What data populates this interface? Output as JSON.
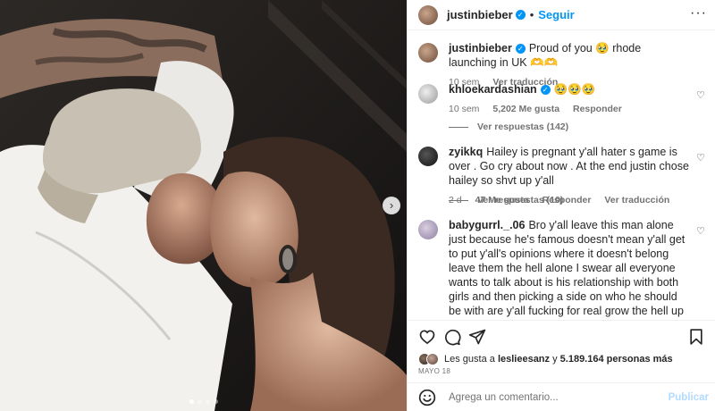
{
  "header": {
    "username": "justinbieber",
    "separator": "•",
    "follow_label": "Seguir",
    "more_icon": "more-horizontal-icon"
  },
  "caption": {
    "username": "justinbieber",
    "text": "Proud of you 🥹 rhode launching in UK 🫶🫶",
    "time": "10 sem",
    "translate": "Ver traducción"
  },
  "comments": [
    {
      "username": "khloekardashian",
      "verified": true,
      "text": "🥹🥹🥹",
      "time": "10 sem",
      "likes": "5,202 Me gusta",
      "reply": "Responder",
      "replies": "Ver respuestas (142)"
    },
    {
      "username": "zyikkq",
      "verified": false,
      "text": "Hailey is pregnant y'all hater s game is over . Go cry about now . At the end justin chose hailey so shvt up y'all",
      "time": "2 d",
      "likes": "47 Me gusta",
      "reply": "Responder",
      "translate": "Ver traducción",
      "replies": "Ver respuestas (10)"
    },
    {
      "username": "babygurrl._.06",
      "verified": false,
      "text": "Bro y'all leave this man alone just because he's famous doesn't mean y'all get to put y'all's opinions where it doesn't belong leave them the hell alone I swear all everyone wants to talk about is his relationship with both girls and then picking a side on who he should be with are y'all fucking for real grow the hell up and get off his page if you don't like the girl he's with unfollow him at this point y'all are making their lives Miserable they are happy with their marriage let them be"
    }
  ],
  "likes": {
    "prefix": "Les gusta a",
    "user": "leslieesanz",
    "connector": "y",
    "others": "5.189.164 personas más"
  },
  "date": "MAYO 18",
  "composer": {
    "placeholder": "Agrega un comentario...",
    "publish_label": "Publicar"
  },
  "colors": {
    "accent": "#0095f6",
    "publish_disabled": "#b3dbff",
    "muted_text": "#737373"
  }
}
